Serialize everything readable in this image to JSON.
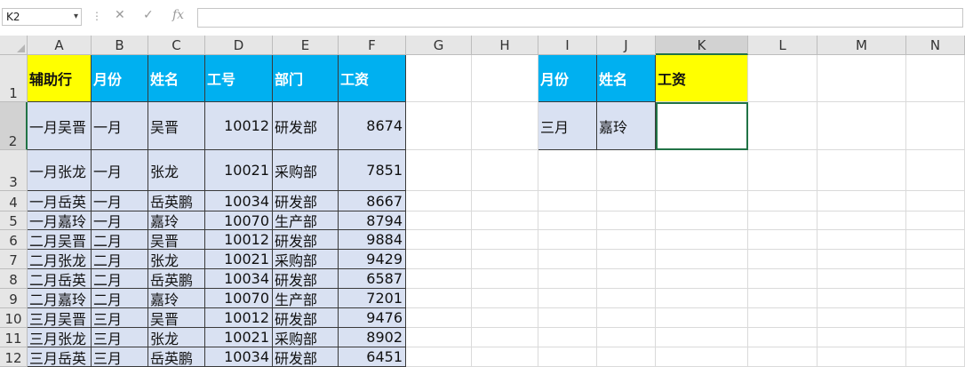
{
  "formula_bar": {
    "name_box": "K2",
    "cancel_glyph": "✕",
    "confirm_glyph": "✓",
    "fx_label": "fx",
    "formula": ""
  },
  "colors": {
    "header_blue": "#00b0f0",
    "header_yellow": "#ffff00",
    "data_fill": "#d9e1f2",
    "excel_green": "#217346"
  },
  "columns": [
    "A",
    "B",
    "C",
    "D",
    "E",
    "F",
    "G",
    "H",
    "I",
    "J",
    "K",
    "L",
    "M",
    "N"
  ],
  "rows": [
    "1",
    "2",
    "3",
    "4",
    "5",
    "6",
    "7",
    "8",
    "9",
    "10",
    "11",
    "12"
  ],
  "main_table": {
    "headers": [
      "辅助行",
      "月份",
      "姓名",
      "工号",
      "部门",
      "工资"
    ],
    "rows": [
      [
        "一月吴晋",
        "一月",
        "吴晋",
        "10012",
        "研发部",
        "8674"
      ],
      [
        "一月张龙",
        "一月",
        "张龙",
        "10021",
        "采购部",
        "7851"
      ],
      [
        "一月岳英",
        "一月",
        "岳英鹏",
        "10034",
        "研发部",
        "8667"
      ],
      [
        "一月嘉玲",
        "一月",
        "嘉玲",
        "10070",
        "生产部",
        "8794"
      ],
      [
        "二月吴晋",
        "二月",
        "吴晋",
        "10012",
        "研发部",
        "9884"
      ],
      [
        "二月张龙",
        "二月",
        "张龙",
        "10021",
        "采购部",
        "9429"
      ],
      [
        "二月岳英",
        "二月",
        "岳英鹏",
        "10034",
        "研发部",
        "6587"
      ],
      [
        "二月嘉玲",
        "二月",
        "嘉玲",
        "10070",
        "生产部",
        "7201"
      ],
      [
        "三月吴晋",
        "三月",
        "吴晋",
        "10012",
        "研发部",
        "9476"
      ],
      [
        "三月张龙",
        "三月",
        "张龙",
        "10021",
        "采购部",
        "8902"
      ],
      [
        "三月岳英",
        "三月",
        "岳英鹏",
        "10034",
        "研发部",
        "6451"
      ]
    ]
  },
  "lookup_table": {
    "headers": [
      "月份",
      "姓名",
      "工资"
    ],
    "row": [
      "三月",
      "嘉玲",
      ""
    ]
  }
}
